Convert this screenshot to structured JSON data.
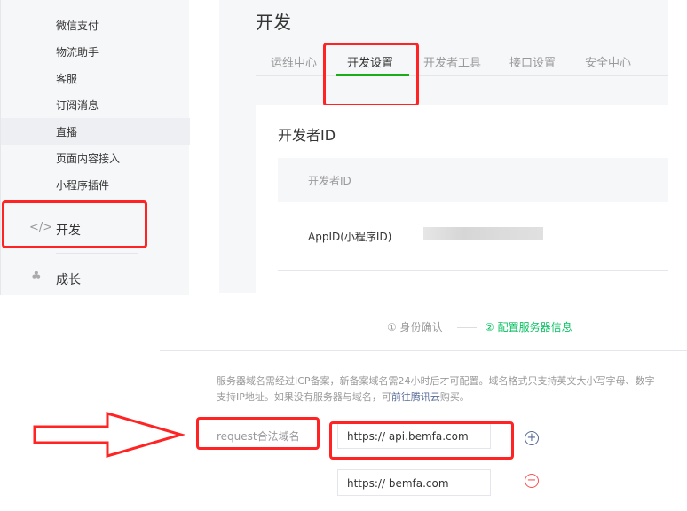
{
  "sidebar": {
    "items": [
      "微信支付",
      "物流助手",
      "客服",
      "订阅消息",
      "直播",
      "页面内容接入",
      "小程序插件"
    ],
    "dev": "开发",
    "grow": "成长"
  },
  "main": {
    "title": "开发",
    "tabs": [
      "运维中心",
      "开发设置",
      "开发者工具",
      "接口设置",
      "安全中心"
    ]
  },
  "card": {
    "title": "开发者ID",
    "header": "开发者ID",
    "appid_label": "AppID(小程序ID)"
  },
  "steps": {
    "s1_num": "①",
    "s1": "身份确认",
    "s2_num": "②",
    "s2": "配置服务器信息"
  },
  "notice": {
    "line1": "服务器域名需经过ICP备案，新备案域名需24小时后才可配置。域名格式只支持英文大小写字母、数字",
    "line2a": "支持IP地址。如果没有服务器与域名，可",
    "link": "前往腾讯云",
    "line2b": "购买。"
  },
  "form": {
    "label": "request合法域名",
    "values": [
      "https:// api.bemfa.com",
      "https:// bemfa.com"
    ]
  },
  "colors": {
    "accent": "#07c160",
    "annotation": "#ff2323",
    "link": "#576b95"
  }
}
